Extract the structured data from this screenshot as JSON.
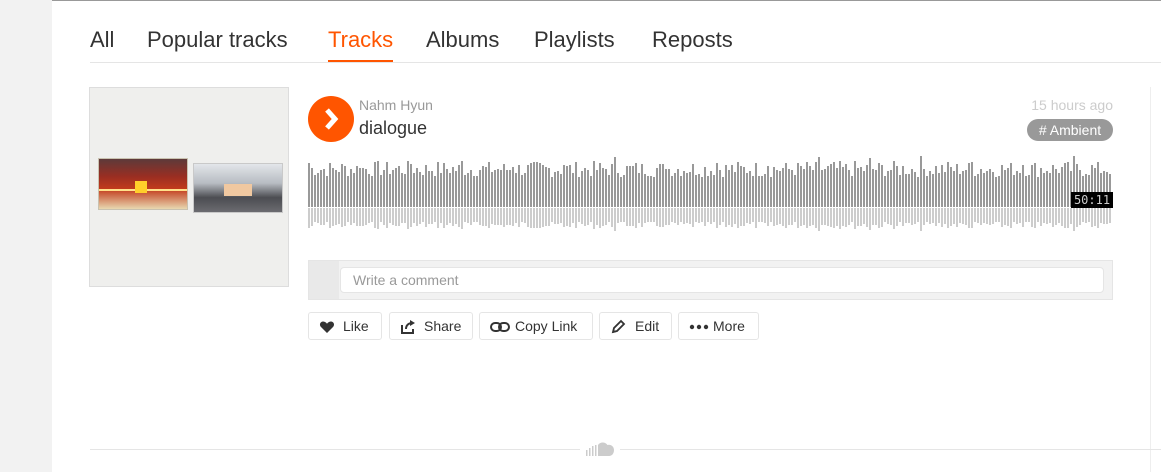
{
  "tabs": [
    {
      "label": "All",
      "active": false
    },
    {
      "label": "Popular tracks",
      "active": false
    },
    {
      "label": "Tracks",
      "active": true
    },
    {
      "label": "Albums",
      "active": false
    },
    {
      "label": "Playlists",
      "active": false
    },
    {
      "label": "Reposts",
      "active": false
    }
  ],
  "track": {
    "username": "Nahm Hyun",
    "title": "dialogue",
    "posted": "15 hours ago",
    "tag": "# Ambient",
    "duration": "50:11"
  },
  "comment": {
    "placeholder": "Write a comment"
  },
  "actions": {
    "like": "Like",
    "share": "Share",
    "copy_link": "Copy Link",
    "edit": "Edit",
    "more": "More"
  },
  "colors": {
    "accent": "#ff5500",
    "waveform": "#999999",
    "waveform_reflection": "#cccccc"
  },
  "icons": [
    "play-icon",
    "heart-icon",
    "share-icon",
    "link-icon",
    "pencil-icon",
    "more-dots-icon",
    "soundcloud-logo-icon"
  ]
}
